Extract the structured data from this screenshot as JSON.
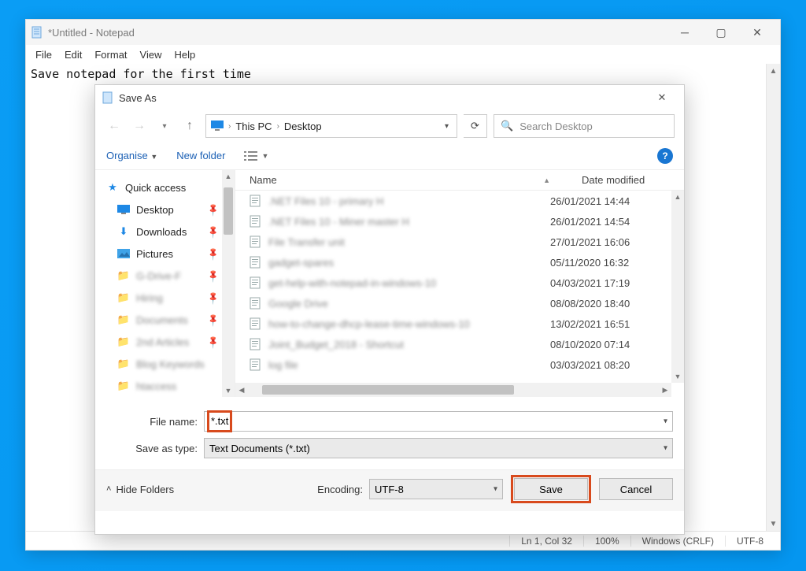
{
  "notepad": {
    "title": "*Untitled - Notepad",
    "menu": {
      "file": "File",
      "edit": "Edit",
      "format": "Format",
      "view": "View",
      "help": "Help"
    },
    "content": "Save notepad for the first time",
    "status": {
      "pos": "Ln 1, Col 32",
      "zoom": "100%",
      "eol": "Windows (CRLF)",
      "enc": "UTF-8"
    }
  },
  "dialog": {
    "title": "Save As",
    "path": {
      "seg1": "This PC",
      "seg2": "Desktop"
    },
    "search_placeholder": "Search Desktop",
    "toolbar": {
      "organise": "Organise",
      "new_folder": "New folder"
    },
    "columns": {
      "name": "Name",
      "date": "Date modified"
    },
    "nav": {
      "quick_access": "Quick access",
      "desktop": "Desktop",
      "downloads": "Downloads",
      "pictures": "Pictures",
      "blur1": "G-Drive-F",
      "blur2": "Hiring",
      "blur3": "Documents",
      "blur4": "2nd Articles",
      "blur5": "Blog Keywords",
      "blur6": "htaccess"
    },
    "files": [
      {
        "name": ".NET Files 10 - primary H",
        "date": "26/01/2021 14:44"
      },
      {
        "name": ".NET Files 10 - Miner master H",
        "date": "26/01/2021 14:54"
      },
      {
        "name": "File Transfer unit",
        "date": "27/01/2021 16:06"
      },
      {
        "name": "gadget-spares",
        "date": "05/11/2020 16:32"
      },
      {
        "name": "get-help-with-notepad-in-windows-10",
        "date": "04/03/2021 17:19"
      },
      {
        "name": "Google Drive",
        "date": "08/08/2020 18:40"
      },
      {
        "name": "how-to-change-dhcp-lease-time-windows-10",
        "date": "13/02/2021 16:51"
      },
      {
        "name": "Joint_Budget_2018 - Shortcut",
        "date": "08/10/2020 07:14"
      },
      {
        "name": "log file",
        "date": "03/03/2021 08:20"
      }
    ],
    "file_name_label": "File name:",
    "file_name_value": "*.txt",
    "save_type_label": "Save as type:",
    "save_type_value": "Text Documents (*.txt)",
    "hide_folders": "Hide Folders",
    "encoding_label": "Encoding:",
    "encoding_value": "UTF-8",
    "save": "Save",
    "cancel": "Cancel"
  }
}
